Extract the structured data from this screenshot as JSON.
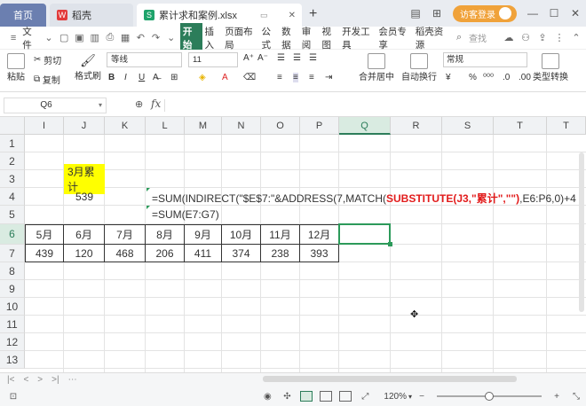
{
  "titlebar": {
    "tabs": [
      {
        "label": "首页"
      },
      {
        "label": "稻壳"
      },
      {
        "label": "累计求和案例.xlsx"
      }
    ],
    "login_label": "访客登录"
  },
  "menubar": {
    "file_label": "文件",
    "items": [
      "开始",
      "插入",
      "页面布局",
      "公式",
      "数据",
      "审阅",
      "视图",
      "开发工具",
      "会员专享",
      "稻壳资源"
    ],
    "search_placeholder": "查找"
  },
  "ribbon": {
    "paste_label": "粘贴",
    "cut_label": "剪切",
    "copy_label": "复制",
    "format_painter_label": "格式刷",
    "font_name": "等线",
    "font_size": "11",
    "merge_label": "合并居中",
    "wrap_label": "自动换行",
    "number_format": "常规",
    "type_convert_label": "类型转换"
  },
  "formula_bar": {
    "cell_ref": "Q6",
    "fx_label": "fx",
    "content": ""
  },
  "columns": [
    "I",
    "J",
    "K",
    "L",
    "M",
    "N",
    "O",
    "P",
    "Q",
    "R",
    "S",
    "T"
  ],
  "rows": [
    "1",
    "2",
    "3",
    "4",
    "5",
    "6",
    "7",
    "8",
    "9",
    "10",
    "11",
    "12",
    "13"
  ],
  "cells": {
    "label_3月累计": "3月累计",
    "value_539": "539",
    "formula_j4_prefix": "=SUM(INDIRECT(\"$E$7:\"&ADDRESS(7,MATCH(",
    "formula_j4_red": "SUBSTITUTE(J3,\"累计\",\"\")",
    "formula_j4_suffix": ",E6:P6,0)+4",
    "formula_j5": "=SUM(E7:G7)",
    "months": [
      "5月",
      "6月",
      "7月",
      "8月",
      "9月",
      "10月",
      "11月",
      "12月"
    ],
    "values": [
      "439",
      "120",
      "468",
      "206",
      "411",
      "374",
      "238",
      "393"
    ]
  },
  "statusbar": {
    "zoom": "120%"
  }
}
